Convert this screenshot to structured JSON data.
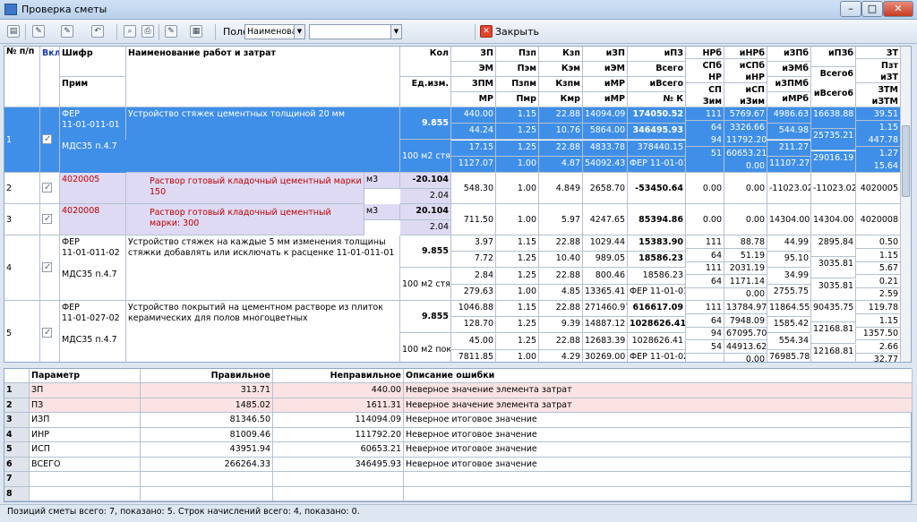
{
  "window": {
    "title": "Проверка сметы",
    "min": "–",
    "max": "□",
    "close": "✕"
  },
  "toolbar": {
    "field_label": "Поле",
    "field_value": "Наименован",
    "close_label": "Закрыть"
  },
  "headers": {
    "num": "№ п/п",
    "vkl": "Вкл",
    "shifr": "Шифр",
    "prim": "Прим",
    "name": "Наименование работ и затрат",
    "kol": "Кол",
    "edizm": "Ед.изм.",
    "a": [
      "ЗП",
      "ЭМ",
      "ЗПМ",
      "МР"
    ],
    "b": [
      "Пзп",
      "Пэм",
      "Пзпм",
      "Пмр"
    ],
    "c": [
      "Кзп",
      "Кэм",
      "Кзпм",
      "Кмр"
    ],
    "d": [
      "иЗП",
      "иЭМ",
      "иМР",
      "иМР"
    ],
    "e": [
      "иПЗ",
      "Всего",
      "иВсего",
      "№ К"
    ],
    "f": [
      "НРб",
      "СПб",
      "НР",
      "СП",
      "Зим"
    ],
    "g": [
      "иНРб",
      "иСПб",
      "иНР",
      "иСП",
      "иЗим"
    ],
    "h": [
      "иЗПб",
      "иЭМб",
      "иЗПМб",
      "иМРб"
    ],
    "i": [
      "иПЗб",
      "Всего6",
      "иВсего6"
    ],
    "j": [
      "ЗТ",
      "Пзт",
      "иЗТ",
      "ЗТМ",
      "иЗТМ"
    ]
  },
  "rows": [
    {
      "n": "1",
      "code": "ФЕР\n11-01-011-01",
      "prim": "МДС35 п.4.7",
      "name": "Устройство стяжек цементных толщиной 20 мм",
      "kol": "9.855",
      "ed": "100 м2 стя:",
      "a": [
        "440.00",
        "44.24",
        "17.15",
        "1127.07"
      ],
      "b": [
        "1.15",
        "1.25",
        "1.25",
        "1.00"
      ],
      "c": [
        "22.88",
        "10.76",
        "22.88",
        "4.87"
      ],
      "d": [
        "14094.09",
        "5864.00",
        "4833.78",
        "54092.43"
      ],
      "e": [
        "174050.52",
        "346495.93",
        "378440.15",
        "ФЕР 11-01-01"
      ],
      "f": [
        "111",
        "64",
        "94",
        "51",
        ""
      ],
      "g": [
        "5769.67",
        "3326.66",
        "11792.20",
        "60653.21",
        "0.00"
      ],
      "h": [
        "4986.63",
        "544.98",
        "211.27",
        "11107.27"
      ],
      "i": [
        "16638.88",
        "25735.21",
        "29016.19"
      ],
      "j": [
        "39.51",
        "1.15",
        "447.78",
        "1.27",
        "15.64"
      ]
    },
    {
      "n": "2",
      "code": "4020005",
      "name": "Раствор готовый кладочный цементный марки 150",
      "unit": "м3",
      "kol": "-20.104",
      "kol2": "2.04",
      "vals": [
        "548.30",
        "1.00",
        "4.849",
        "2658.70",
        "-53450.64",
        "0.00",
        "0.00",
        "-11023.02",
        "-11023.02",
        "4020005"
      ]
    },
    {
      "n": "3",
      "code": "4020008",
      "name": "Раствор готовый кладочный цементный марки: 300",
      "unit": "м3",
      "kol": "20.104",
      "kol2": "2.04",
      "vals": [
        "711.50",
        "1.00",
        "5.97",
        "4247.65",
        "85394.86",
        "0.00",
        "0.00",
        "14304.00",
        "14304.00",
        "4020008"
      ]
    },
    {
      "n": "4",
      "code": "ФЕР\n11-01-011-02",
      "prim": "МДС35 п.4.7",
      "name": "Устройство стяжек на каждые 5 мм изменения толщины стяжки добавлять или исключать к расценке 11-01-011-01",
      "kol": "9.855",
      "ed": "100 м2 стя:",
      "a": [
        "3.97",
        "7.72",
        "2.84",
        "279.63"
      ],
      "b": [
        "1.15",
        "1.25",
        "1.25",
        "1.00"
      ],
      "c": [
        "22.88",
        "10.40",
        "22.88",
        "4.85"
      ],
      "d": [
        "1029.44",
        "989.05",
        "800.46",
        "13365.41"
      ],
      "e": [
        "15383.90",
        "18586.23",
        "18586.23",
        "ФЕР 11-01-01"
      ],
      "f": [
        "111",
        "64",
        "111",
        "64",
        ""
      ],
      "g": [
        "88.78",
        "51.19",
        "2031.19",
        "1171.14",
        "0.00"
      ],
      "h": [
        "44.99",
        "95.10",
        "34.99",
        "2755.75"
      ],
      "i": [
        "2895.84",
        "3035.81",
        "3035.81"
      ],
      "j": [
        "0.50",
        "1.15",
        "5.67",
        "0.21",
        "2.59"
      ]
    },
    {
      "n": "5",
      "code": "ФЕР\n11-01-027-02",
      "prim": "МДС35 п.4.7",
      "name": "Устройство покрытий на цементном растворе из плиток керамических для полов многоцветных",
      "kol": "9.855",
      "ed": "100 м2 пок",
      "a": [
        "1046.88",
        "128.70",
        "45.00",
        "7811.85"
      ],
      "b": [
        "1.15",
        "1.25",
        "1.25",
        "1.00"
      ],
      "c": [
        "22.88",
        "9.39",
        "22.88",
        "4.29"
      ],
      "d": [
        "271460.97",
        "14887.12",
        "12683.39",
        "30269.00"
      ],
      "e": [
        "616617.09",
        "1028626.41",
        "1028626.41",
        "ФЕР 11-01-02"
      ],
      "f": [
        "111",
        "64",
        "94",
        "54",
        ""
      ],
      "g": [
        "13784.97",
        "7948.09",
        "67095.70",
        "44913.62",
        "0.00"
      ],
      "h": [
        "11864.55",
        "1585.42",
        "554.34",
        "76985.78"
      ],
      "i": [
        "90435.75",
        "12168.81",
        "12168.81"
      ],
      "j": [
        "119.78",
        "1.15",
        "1357.50",
        "2.66",
        "32.77"
      ]
    }
  ],
  "errors": {
    "headers": [
      "Параметр",
      "Правильное",
      "Неправильное",
      "Описание ошибки"
    ],
    "rows": [
      [
        "1",
        "ЗП",
        "313.71",
        "440.00",
        "Неверное значение элемента затрат"
      ],
      [
        "2",
        "ПЗ",
        "1485.02",
        "1611.31",
        "Неверное значение элемента затрат"
      ],
      [
        "3",
        "ИЗП",
        "81346.50",
        "114094.09",
        "Неверное итоговое значение"
      ],
      [
        "4",
        "ИНР",
        "81009.46",
        "111792.20",
        "Неверное итоговое значение"
      ],
      [
        "5",
        "ИСП",
        "43951.94",
        "60653.21",
        "Неверное итоговое значение"
      ],
      [
        "6",
        "ВСЕГО",
        "266264.33",
        "346495.93",
        "Неверное итоговое значение"
      ],
      [
        "7",
        "",
        "",
        "",
        ""
      ],
      [
        "8",
        "",
        "",
        "",
        ""
      ]
    ]
  },
  "status": "Позиций сметы всего: 7, показано: 5.  Строк начислений всего: 4, показано: 0."
}
